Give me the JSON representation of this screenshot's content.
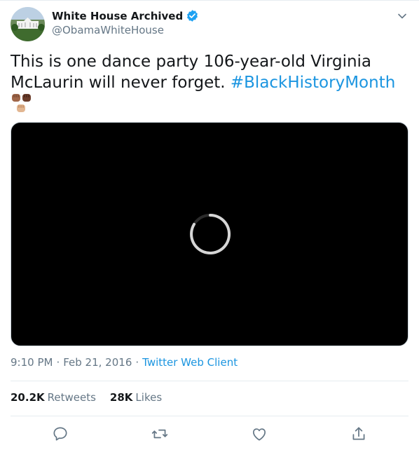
{
  "account": {
    "display_name": "White House Archived",
    "handle": "@ObamaWhiteHouse",
    "verified": true
  },
  "tweet": {
    "text_before": "This is one dance party 106-year-old Virginia McLaurin will never forget. ",
    "hashtag": "#BlackHistoryMonth",
    "emoji": [
      "raised-fist-medium-dark",
      "raised-fist-dark",
      "raised-fist-medium-light"
    ]
  },
  "media": {
    "state": "loading",
    "icon": "loading-spinner-icon"
  },
  "meta": {
    "time": "9:10 PM",
    "separator": "·",
    "date": "Feb 21, 2016",
    "client": "Twitter Web Client"
  },
  "stats": {
    "retweets_count": "20.2K",
    "retweets_label": "Retweets",
    "likes_count": "28K",
    "likes_label": "Likes"
  },
  "actions": [
    "reply-icon",
    "retweet-icon",
    "like-icon",
    "share-icon"
  ],
  "colors": {
    "link": "#1b95e0",
    "secondary_text": "#657786",
    "primary_text": "#14171a",
    "verified": "#1da1f2",
    "divider": "#e6ecf0"
  }
}
